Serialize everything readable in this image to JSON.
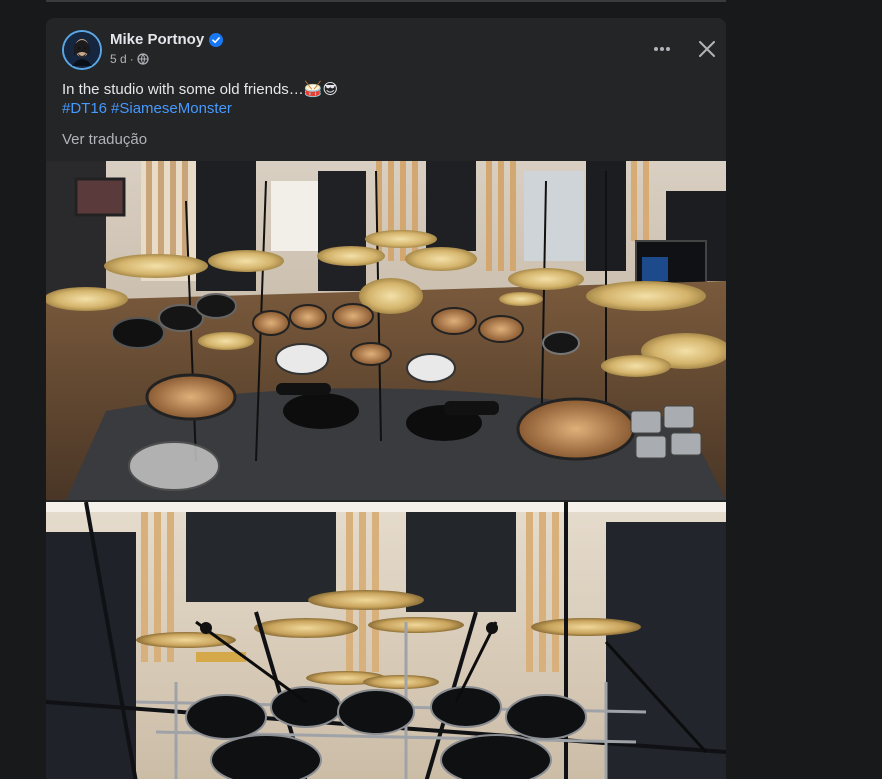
{
  "post": {
    "author": "Mike Portnoy",
    "time": "5 d",
    "text": "In the studio with some old friends…🥁😎",
    "hashtags": [
      "#DT16",
      "#SiameseMonster"
    ],
    "translate_label": "Ver tradução"
  },
  "icons": {
    "verified": "verified-badge-icon",
    "audience": "globe-icon",
    "more": "more-options-icon",
    "close": "close-icon"
  },
  "colors": {
    "page_bg": "#18191a",
    "card_bg": "#242526",
    "text": "#e4e6eb",
    "secondary_text": "#b0b3b8",
    "link": "#4599ff",
    "verified": "#1877f2"
  }
}
